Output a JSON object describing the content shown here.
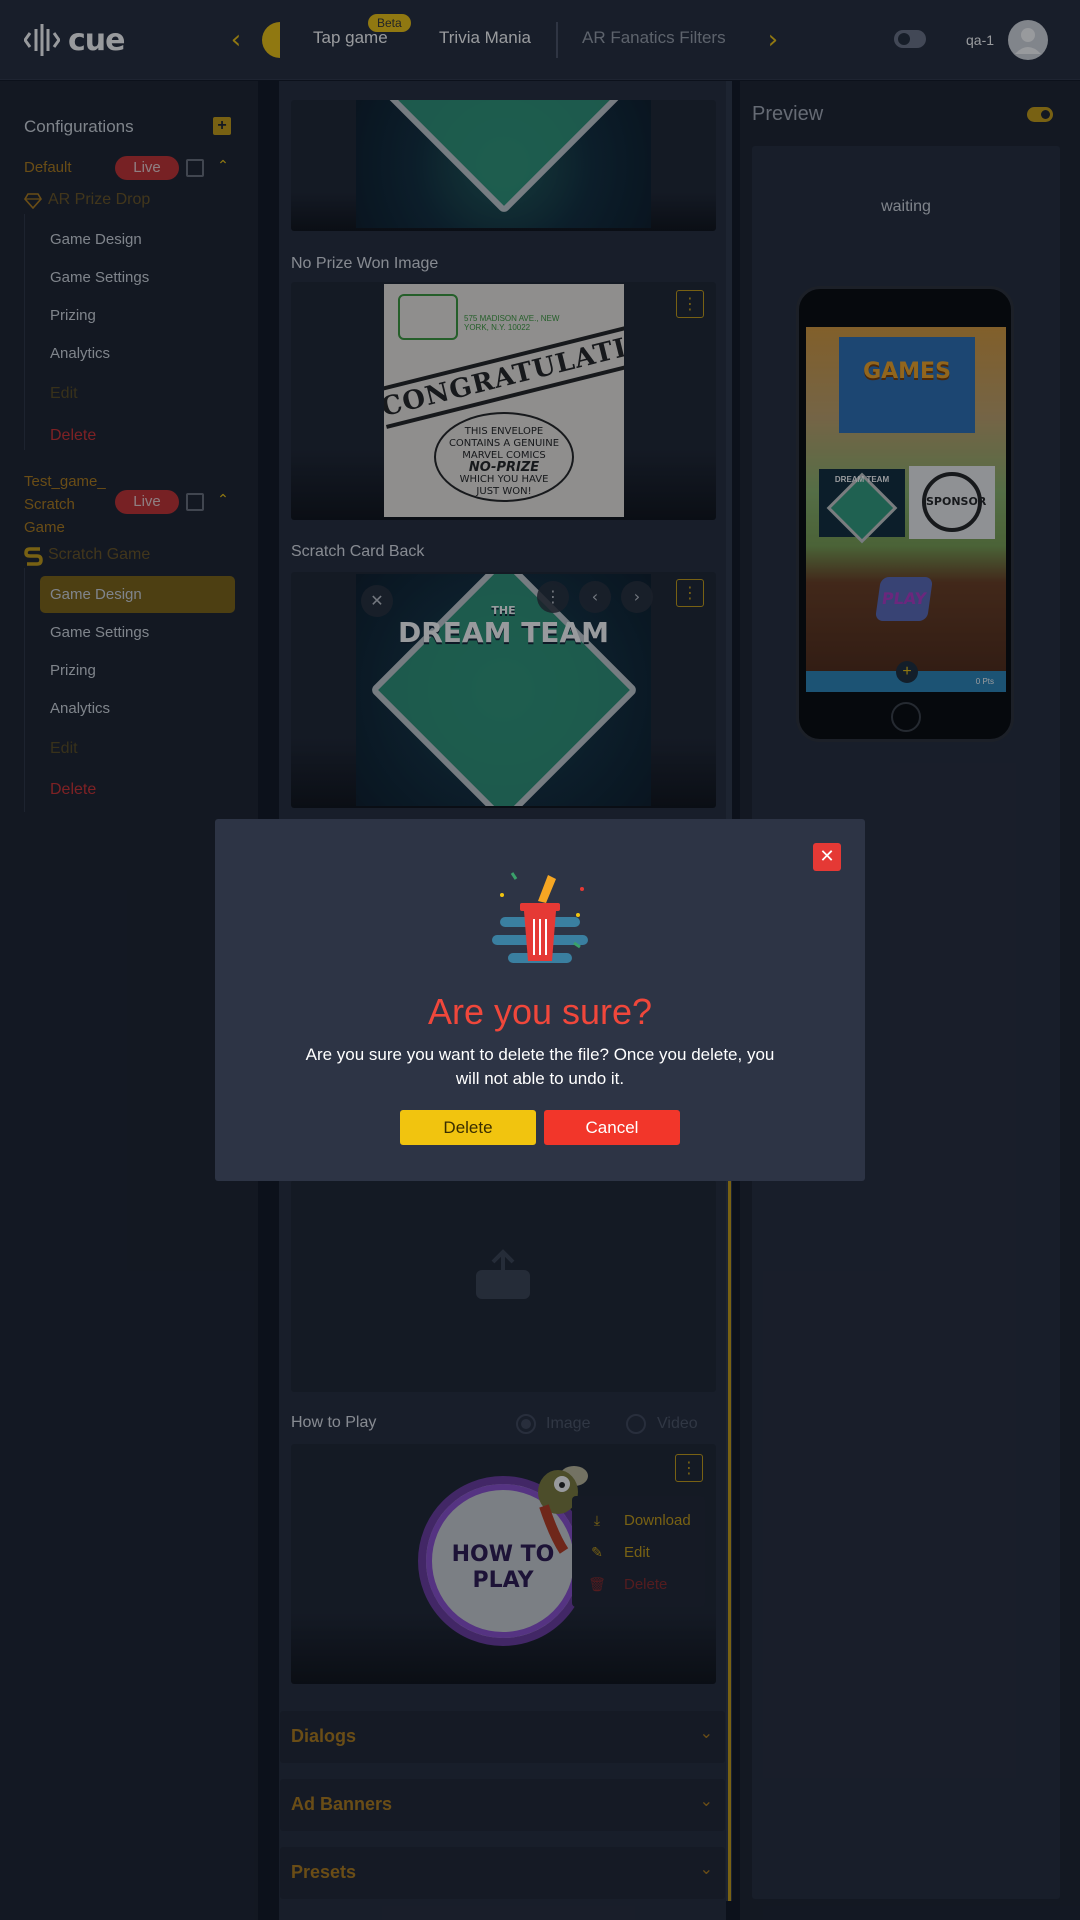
{
  "header": {
    "logo_text": "cue",
    "tabs": [
      {
        "label": "Tap game",
        "badge": "Beta"
      },
      {
        "label": "Trivia Mania"
      },
      {
        "label": "AR Fanatics Filters"
      }
    ],
    "user": "qa-1"
  },
  "sidebar": {
    "title": "Configurations",
    "configs": [
      {
        "name": "Default",
        "status": "Live",
        "game": "AR Prize Drop",
        "items": [
          "Game Design",
          "Game Settings",
          "Prizing",
          "Analytics"
        ],
        "edit": "Edit",
        "delete": "Delete"
      },
      {
        "name_lines": [
          "Test_game_",
          "Scratch",
          "Game"
        ],
        "status": "Live",
        "game": "Scratch Game",
        "items": [
          "Game Design",
          "Game Settings",
          "Prizing",
          "Analytics"
        ],
        "active_item": "Game Design",
        "edit": "Edit",
        "delete": "Delete"
      }
    ]
  },
  "main": {
    "no_prize_label": "No Prize Won Image",
    "no_prize_image_text": {
      "headline": "CONGRATULATIONS!",
      "burst_lines": [
        "THIS ENVELOPE",
        "CONTAINS A GENUINE",
        "MARVEL COMICS",
        "NO-PRIZE",
        "WHICH YOU HAVE",
        "JUST WON!"
      ],
      "address": "575 MADISON AVE., NEW YORK, N.Y. 10022"
    },
    "scratch_back_label": "Scratch Card Back",
    "mascot_text": {
      "small": "THE",
      "big": "DREAM TEAM"
    },
    "how_to_play_label": "How to Play",
    "media_options": [
      "Image",
      "Video"
    ],
    "how_to_play_image_text": "HOW TO PLAY",
    "context_menu": [
      "Download",
      "Edit",
      "Delete"
    ],
    "accordions": [
      "Dialogs",
      "Ad Banners",
      "Presets"
    ]
  },
  "preview": {
    "title": "Preview",
    "status": "waiting",
    "screen": {
      "games_title": "GAMES",
      "sponsor": "SPONSOR",
      "play": "PLAY",
      "thumb_text": "DREAM TEAM",
      "points": "0 Pts"
    }
  },
  "modal": {
    "title": "Are you sure?",
    "message": "Are you sure you want to delete the file? Once you delete, you will not able to undo it.",
    "delete_label": "Delete",
    "cancel_label": "Cancel"
  },
  "colors": {
    "accent": "#f1c40f",
    "danger": "#f0473b",
    "live": "#c62f2f",
    "background": "#0f1420"
  }
}
